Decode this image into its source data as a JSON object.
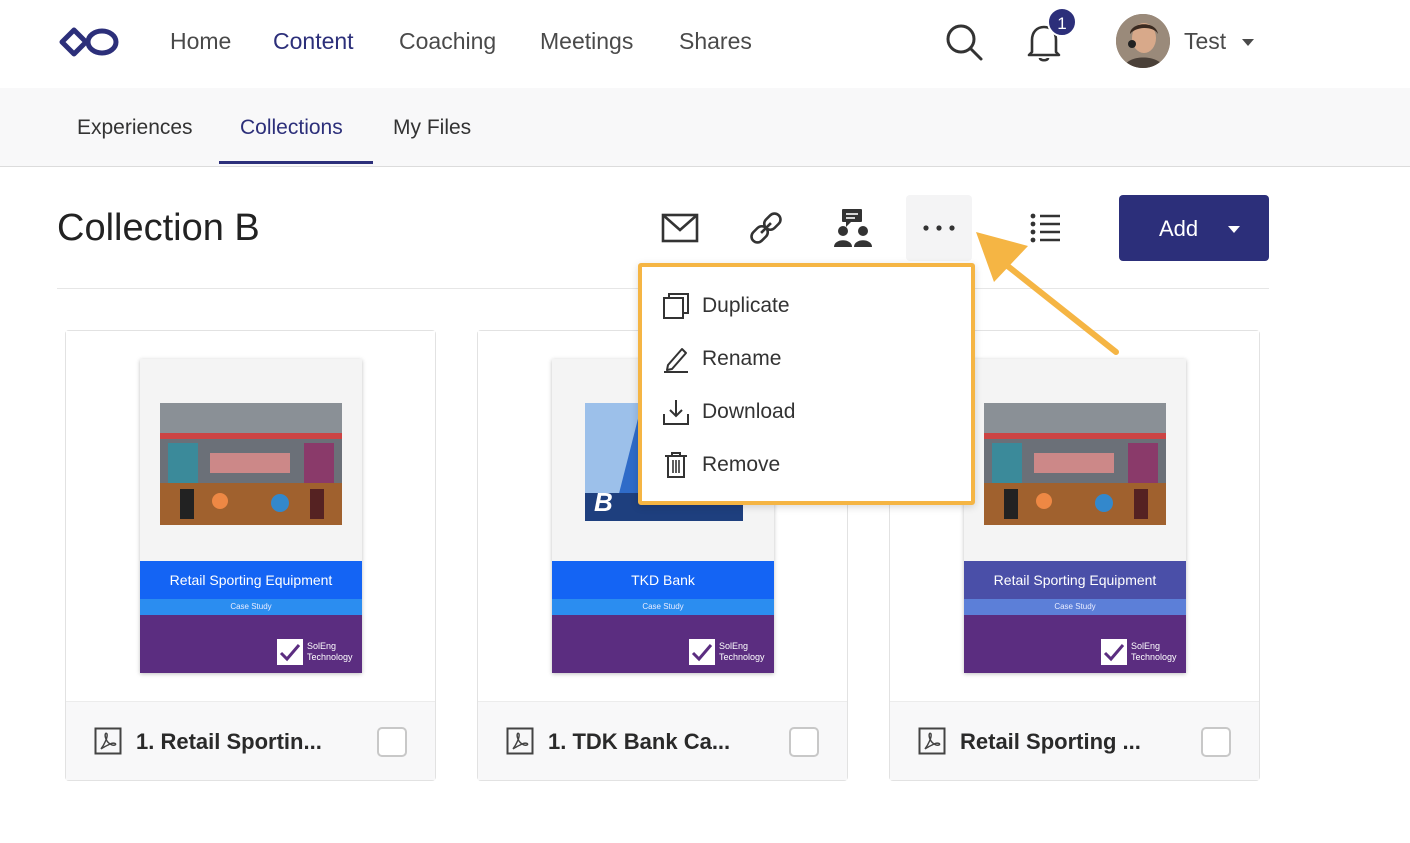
{
  "topnav": {
    "items": [
      {
        "label": "Home",
        "active": false
      },
      {
        "label": "Content",
        "active": true
      },
      {
        "label": "Coaching",
        "active": false
      },
      {
        "label": "Meetings",
        "active": false
      },
      {
        "label": "Shares",
        "active": false
      }
    ],
    "notification_count": "1",
    "user_name": "Test",
    "icons": [
      "logo-infinity-icon",
      "search-icon",
      "bell-icon",
      "caret-down-icon"
    ]
  },
  "subnav": {
    "tabs": [
      {
        "label": "Experiences",
        "active": false
      },
      {
        "label": "Collections",
        "active": true
      },
      {
        "label": "My Files",
        "active": false
      }
    ]
  },
  "header": {
    "title": "Collection B",
    "tools": [
      "email-icon",
      "link-icon",
      "presenter-icon",
      "more-icon",
      "list-view-icon"
    ],
    "add_label": "Add"
  },
  "menu": {
    "items": [
      {
        "label": "Duplicate",
        "icon": "duplicate-icon"
      },
      {
        "label": "Rename",
        "icon": "pencil-icon"
      },
      {
        "label": "Download",
        "icon": "download-icon"
      },
      {
        "label": "Remove",
        "icon": "trash-icon"
      }
    ]
  },
  "cards": [
    {
      "name": "1. Retail Sportin...",
      "thumb_title": "Retail Sporting Equipment",
      "thumb_subtitle": "Case Study",
      "brand_line1": "SolEng",
      "brand_line2": "Technology",
      "band_color": "#1464f4",
      "band2_color": "#2b8df0"
    },
    {
      "name": "1. TDK Bank Ca...",
      "thumb_title": "TKD Bank",
      "thumb_subtitle": "Case Study",
      "brand_line1": "SolEng",
      "brand_line2": "Technology",
      "band_color": "#1464f4",
      "band2_color": "#2b8df0"
    },
    {
      "name": "Retail Sporting ...",
      "thumb_title": "Retail Sporting Equipment",
      "thumb_subtitle": "Case Study",
      "brand_line1": "SolEng",
      "brand_line2": "Technology",
      "band_color": "#4a4fa8",
      "band2_color": "#5c7fd8"
    }
  ],
  "colors": {
    "primary": "#2c2f7a",
    "highlight": "#f5b544",
    "brand_purple": "#5b2d80"
  }
}
